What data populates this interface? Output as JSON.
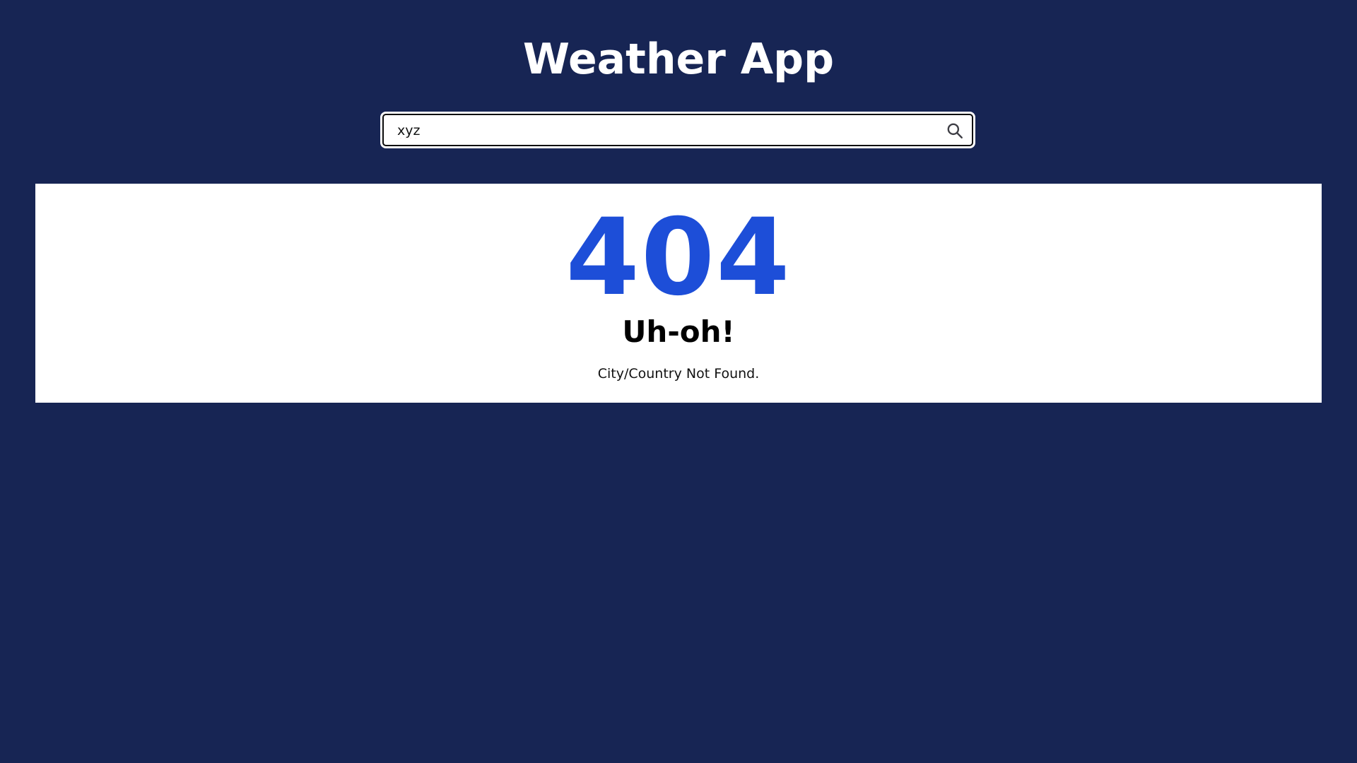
{
  "app": {
    "title": "Weather App"
  },
  "search": {
    "value": "xyz",
    "icon": "search-icon"
  },
  "error": {
    "code": "404",
    "heading": "Uh-oh!",
    "message": "City/Country Not Found."
  },
  "colors": {
    "background": "#172554",
    "card": "#ffffff",
    "accent": "#1d4ed8"
  }
}
